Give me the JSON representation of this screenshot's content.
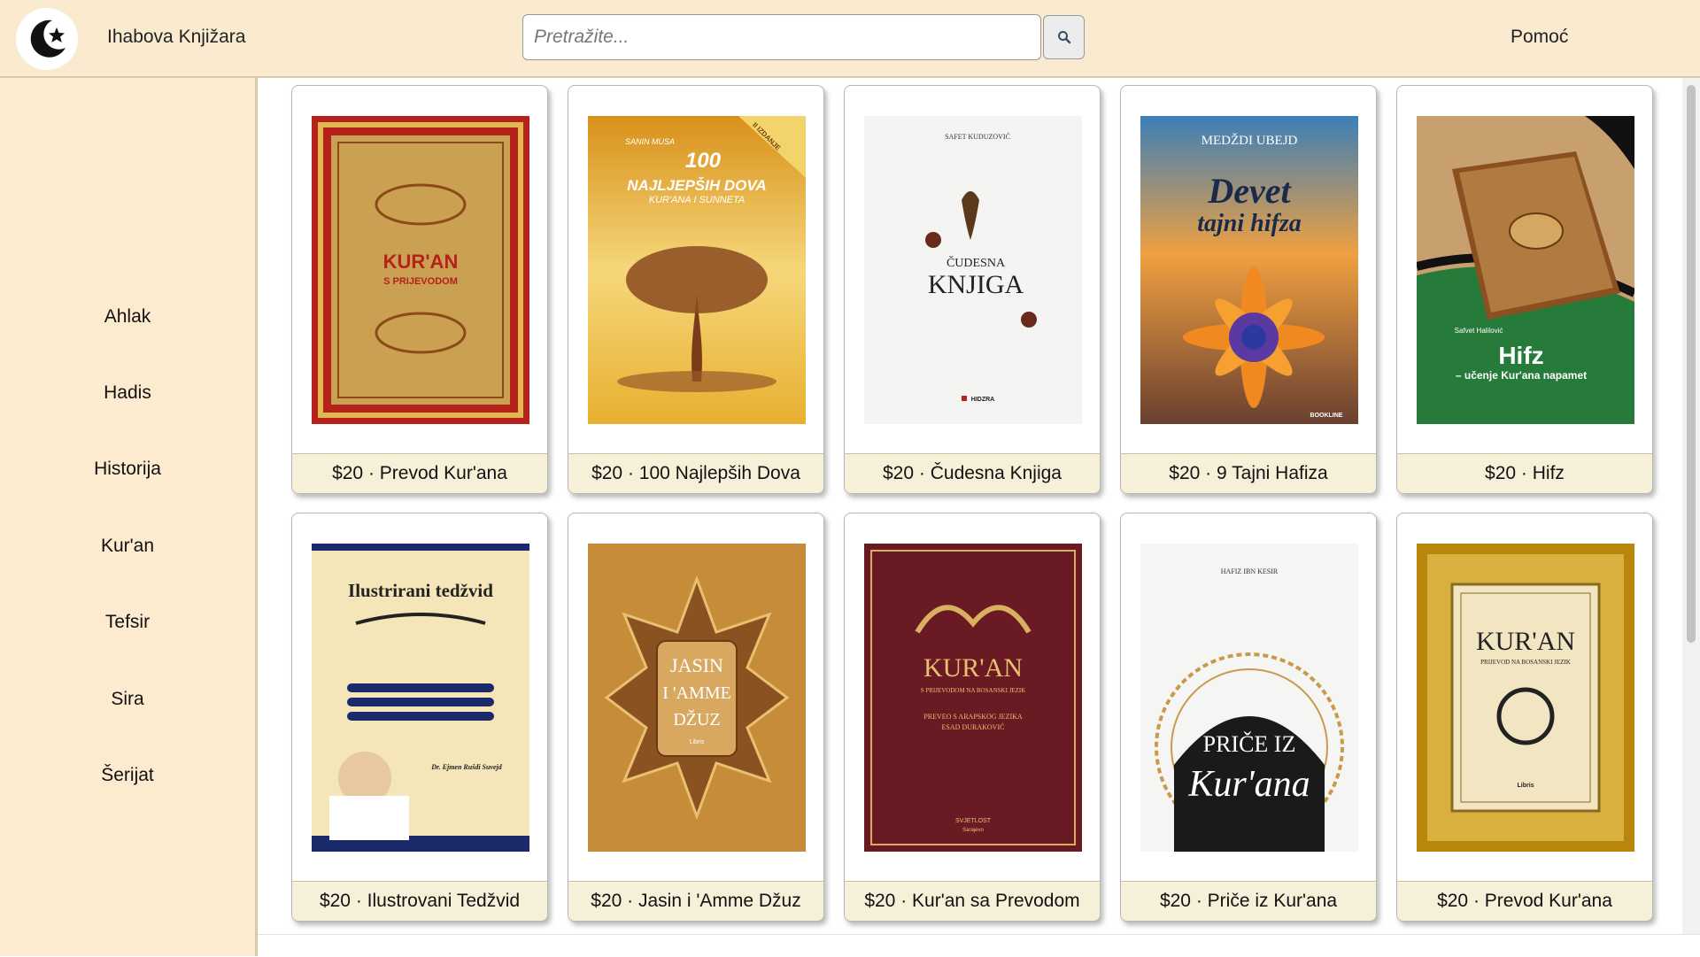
{
  "app": {
    "name": "Ihabova Knjižara",
    "logo_icon": "crescent-star-icon"
  },
  "search": {
    "placeholder": "Pretražite...",
    "button_icon": "search-icon"
  },
  "header": {
    "help_label": "Pomoć"
  },
  "sidebar": {
    "items": [
      {
        "label": "Ahlak"
      },
      {
        "label": "Hadis"
      },
      {
        "label": "Historija"
      },
      {
        "label": "Kur'an"
      },
      {
        "label": "Tefsir"
      },
      {
        "label": "Sira"
      },
      {
        "label": "Šerijat"
      }
    ]
  },
  "books": [
    {
      "price": "$20",
      "title": "Prevod Kur'ana",
      "cover_text": [
        "KUR'AN",
        "S PRIJEVODOM"
      ]
    },
    {
      "price": "$20",
      "title": "100 Najlepših Dova",
      "cover_text": [
        "SANIN MUSA",
        "100",
        "NAJLJEPŠIH DOVA",
        "KUR'ANA I SUNNETA",
        "II IZDANJE"
      ]
    },
    {
      "price": "$20",
      "title": "Čudesna Knjiga",
      "cover_text": [
        "SAFET KUDUZOVIĆ",
        "ČUDESNA",
        "KNJIGA",
        "HIDZRA"
      ]
    },
    {
      "price": "$20",
      "title": "9 Tajni Hafiza",
      "cover_text": [
        "MEDŽDI UBEJD",
        "Devet",
        "tajni hifza",
        "BOOKLINE"
      ]
    },
    {
      "price": "$20",
      "title": "Hifz",
      "cover_text": [
        "Safvet Halilović",
        "Hifz",
        "– učenje Kur'ana napamet"
      ]
    },
    {
      "price": "$20",
      "title": "Ilustrovani Tedžvid",
      "cover_text": [
        "Ilustrirani tedžvid",
        "Dr. Ejmen Rušdi Suvejd"
      ]
    },
    {
      "price": "$20",
      "title": "Jasin i 'Amme Džuz",
      "cover_text": [
        "JASIN",
        "I 'AMME",
        "DŽUZ",
        "Libris"
      ]
    },
    {
      "price": "$20",
      "title": "Kur'an sa Prevodom",
      "cover_text": [
        "KUR'AN",
        "S PRIJEVODOM NA BOSANSKI JEZIK",
        "PREVEO S ARAPSKOG JEZIKA",
        "ESAD DURAKOVIĆ",
        "SVJETLOST",
        "Sarajevo"
      ]
    },
    {
      "price": "$20",
      "title": "Priče iz Kur'ana",
      "cover_text": [
        "HAFIZ IBN KESIR",
        "PRIČE IZ",
        "Kur'ana"
      ]
    },
    {
      "price": "$20",
      "title": "Prevod Kur'ana",
      "cover_text": [
        "KUR'AN",
        "PRIJEVOD NA BOSANSKI JEZIK",
        "Libris"
      ]
    }
  ],
  "colors": {
    "header_bg": "#faebd0",
    "sidebar_bg": "#fcebcf",
    "caption_bg": "#f7f0d8",
    "logo_fg": "#111111"
  }
}
